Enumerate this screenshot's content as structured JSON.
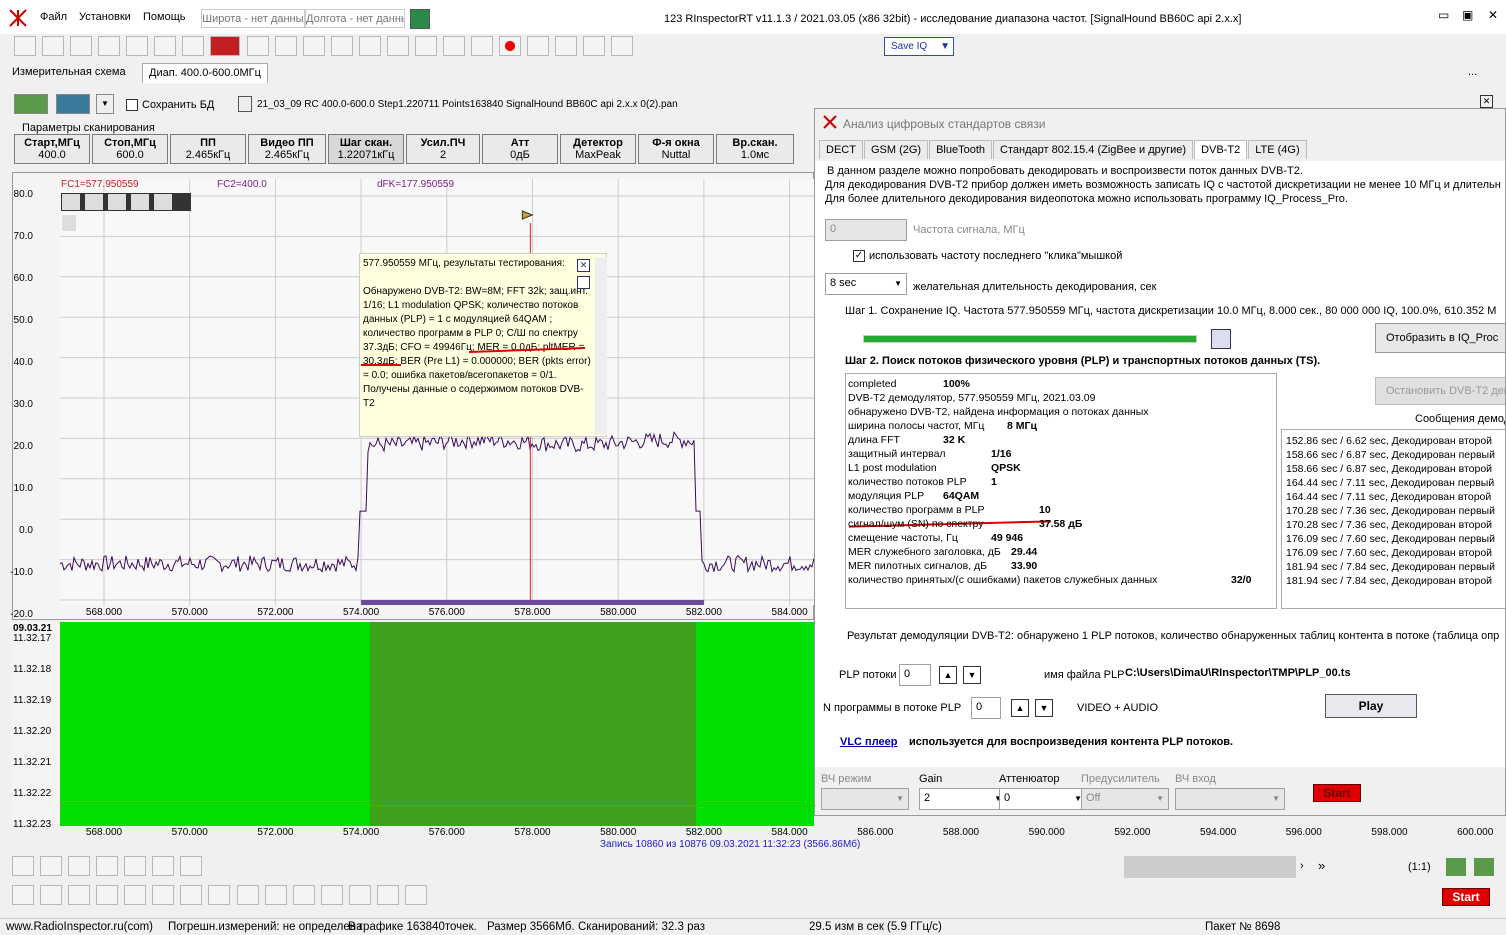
{
  "app": {
    "title": "123 RInspectorRT v11.1.3 / 2021.03.05 (x86 32bit) - исследование диапазона частот. [SignalHound BB60C api 2.x.x]",
    "menu": [
      "Файл",
      "Установки",
      "Помощь"
    ],
    "lat_placeholder": "Широта - нет данных",
    "lon_placeholder": "Долгота - нет данных",
    "saveiq_label": "Save IQ"
  },
  "tabs": {
    "schema": "Измерительная схема",
    "range": "Диап. 400.0-600.0МГц",
    "more": "..."
  },
  "toolbar2": {
    "save_db": "Сохранить БД",
    "file": "21_03_09 RC 400.0-600.0 Step1.220711 Points163840 SignalHound BB60C api 2.x.x 0(2).pan"
  },
  "scan": {
    "group_label": "Параметры сканирования",
    "buttons": [
      {
        "label": "Старт,МГц",
        "value": "400.0"
      },
      {
        "label": "Стоп,МГц",
        "value": "600.0"
      },
      {
        "label": "ПП",
        "value": "2.465кГц"
      },
      {
        "label": "Видео ПП",
        "value": "2.465кГц"
      },
      {
        "label": "Шаг скан.",
        "value": "1.22071кГц"
      },
      {
        "label": "Усил.ПЧ",
        "value": "2"
      },
      {
        "label": "Атт",
        "value": "0дБ"
      },
      {
        "label": "Детектор",
        "value": "MaxPeak"
      },
      {
        "label": "Ф-я окна",
        "value": "Nuttal"
      },
      {
        "label": "Вр.скан.",
        "value": "1.0мс"
      }
    ]
  },
  "spectrum": {
    "fc1": "FC1=577.950559",
    "fc2": "FC2=400.0",
    "dfk": "dFK=177.950559",
    "y_ticks": [
      "80.0",
      "70.0",
      "60.0",
      "50.0",
      "40.0",
      "30.0",
      "20.0",
      "10.0",
      "0.0",
      "-10.0",
      "-20.0"
    ],
    "x_ticks": [
      "568.000",
      "570.000",
      "572.000",
      "574.000",
      "576.000",
      "578.000",
      "580.000",
      "582.000",
      "584.000"
    ],
    "popup": {
      "header": "577.950559 МГц, результаты тестирования:",
      "body": "Обнаружено DVB-T2: BW=8M; FFT 32k; защ.инт. 1/16; L1 modulation QPSK; количество потоков данных (PLP) = 1 с модуляцией 64QAM ; количество программ в PLP 0; С/Ш по спектру 37.3дБ; CFO = 49946Гц; MER = 0.0дБ; pltMER = 30.3дБ; BER (Pre L1) = 0.000000; BER (pkts error) = 0.0; ошибка пакетов/всегопакетов = 0/1. Получены данные о содержимом потоков DVB-T2"
    }
  },
  "waterfall": {
    "date": "09.03.21",
    "times": [
      "11.32.17",
      "11.32.18",
      "11.32.19",
      "11.32.20",
      "11.32.21",
      "11.32.22",
      "11.32.23"
    ],
    "x_ticks": [
      "568.000",
      "570.000",
      "572.000",
      "574.000",
      "576.000",
      "578.000",
      "580.000",
      "582.000",
      "584.000",
      "586.000",
      "588.000",
      "590.000",
      "592.000",
      "594.000",
      "596.000",
      "598.000",
      "600.000"
    ],
    "record": "Запись 10860  из 10876   09.03.2021 11:32:23 (3566.86Мб)"
  },
  "bottom": {
    "ratio": "(1:1)",
    "start": "Start"
  },
  "status": {
    "site": "www.RadioInspector.ru(com)",
    "error": "Погрешн.измерений: не определена",
    "points": "В графике 163840точек.",
    "size": "Размер 3566Мб.",
    "scans": "Сканирований: 32.3 раз",
    "rate": "29.5 изм в сек (5.9 ГГц/с)",
    "packet": "Пакет № 8698"
  },
  "dialog": {
    "title": "Анализ цифровых стандартов связи",
    "tabs": [
      "DECT",
      "GSM (2G)",
      "BlueTooth",
      "Стандарт 802.15.4 (ZigBee и другие)",
      "DVB-T2",
      "LTE (4G)"
    ],
    "active_tab": 4,
    "intro": [
      "В данном разделе можно попробовать декодировать и воспроизвести поток  данных DVB-T2.",
      "Для декодирования DVB-T2 прибор должен иметь возможность записать IQ с частотой дискретизации не менее 10 МГц и длительн",
      "Для более длительного декодирования видеопотока можно использовать программу IQ_Process_Pro."
    ],
    "freq_value": "0",
    "freq_label": "Частота сигнала, МГц",
    "use_click": "использовать частоту последнего \"клика\"мышкой",
    "duration_value": "8 sec",
    "duration_label": "желательная длительность декодирования, сек",
    "step1": "Шаг 1. Сохранение IQ.    Частота 577.950559 МГц, частота дискретизации 10.0 МГц, 8.000 сек.,  80 000 000 IQ,    100.0%,  610.352 М",
    "step1_progress": 1.0,
    "show_iq_btn": "Отобразить в IQ_Proc",
    "stop_btn": "Остановить DVB-T2 дек",
    "step2": "Шаг 2. Поиск потоков физического уровня (PLP) и транспортных потоков данных (TS).",
    "messages_label": "Сообщения демод",
    "info_rows": [
      {
        "k": "completed",
        "v": "100%"
      },
      {
        "k": "DVB-T2 демодулятор, 577.950559 МГц, 2021.03.09",
        "v": ""
      },
      {
        "k": "обнаружено DVB-T2, найдена информация о потоках данных",
        "v": ""
      },
      {
        "k": "ширина полосы частот, МГц",
        "v": "8 МГц"
      },
      {
        "k": "длина FFT",
        "v": "32 K"
      },
      {
        "k": "защитный интервал",
        "v": "1/16"
      },
      {
        "k": "L1 post modulation",
        "v": "QPSK"
      },
      {
        "k": "количество потоков PLP",
        "v": "1"
      },
      {
        "k": "модуляция PLP",
        "v": "64QAM"
      },
      {
        "k": "количество программ  в PLP",
        "v": "10"
      },
      {
        "k": "сигнал/шум (SN) по спектру",
        "v": "37.58 дБ"
      },
      {
        "k": "смещение частоты, Гц",
        "v": "49 946"
      },
      {
        "k": "MER служебного заголовка, дБ",
        "v": "29.44"
      },
      {
        "k": "MER пилотных сигналов, дБ",
        "v": "33.90"
      },
      {
        "k": "количество принятых/(с ошибками) пакетов служебных данных",
        "v": "32/0"
      }
    ],
    "messages": [
      "152.86 sec / 6.62 sec, Декодирован второй",
      "158.66 sec / 6.87 sec, Декодирован первый",
      "158.66 sec / 6.87 sec, Декодирован второй",
      "164.44 sec / 7.11 sec, Декодирован первый",
      "164.44 sec / 7.11 sec, Декодирован второй",
      "170.28 sec / 7.36 sec, Декодирован первый",
      "170.28 sec / 7.36 sec, Декодирован второй",
      "176.09 sec / 7.60 sec, Декодирован первый",
      "176.09 sec / 7.60 sec, Декодирован второй",
      "181.94 sec / 7.84 sec, Декодирован первый",
      "181.94 sec / 7.84 sec, Декодирован второй"
    ],
    "result": "Результат демодуляции DVB-T2: обнаружено 1 PLP потоков, количество обнаруженных таблиц контента в потоке (таблица опр",
    "plp_label": "PLP потоки",
    "plp_value": "0",
    "plp_file_label": "имя файла PLP",
    "plp_file": "C:\\Users\\DimaU\\RInspector\\TMP\\PLP_00.ts",
    "prog_label": "N программы в потоке PLP",
    "prog_value": "0",
    "video_audio": "VIDEO + AUDIO",
    "play": "Play",
    "vlc_link": "VLC плеер",
    "vlc_text": "используется для воспроизведения контента PLP потоков.",
    "hw": [
      {
        "label": "ВЧ режим",
        "value": "",
        "disabled": true
      },
      {
        "label": "Gain",
        "value": "2",
        "disabled": false
      },
      {
        "label": "Аттенюатор",
        "value": "0",
        "disabled": false
      },
      {
        "label": "Предусилитель",
        "value": "Off",
        "disabled": true
      },
      {
        "label": "ВЧ вход",
        "value": "",
        "disabled": true
      }
    ],
    "start": "Start"
  },
  "colors": {
    "accent_red": "#e00000",
    "waterfall_green": "#00e000",
    "band_green": "#3fa21e",
    "trace": "#3a0a5a",
    "marker": "#e02020",
    "progress": "#22aa33",
    "link_blue": "#0000aa"
  }
}
